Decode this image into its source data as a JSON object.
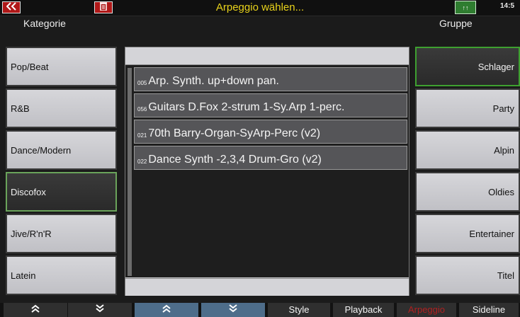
{
  "topbar": {
    "back_icon_label": "«",
    "title": "Arpeggio wählen...",
    "status_icon_label": "↑↑",
    "clock": "14:5"
  },
  "headers": {
    "left": "Kategorie",
    "right": "Gruppe"
  },
  "categories": [
    {
      "label": "Pop/Beat"
    },
    {
      "label": "R&B"
    },
    {
      "label": "Dance/Modern"
    },
    {
      "label": "Discofox"
    },
    {
      "label": "Jive/R'n'R"
    },
    {
      "label": "Latein"
    }
  ],
  "groups": [
    {
      "label": "Schlager"
    },
    {
      "label": "Party"
    },
    {
      "label": "Alpin"
    },
    {
      "label": "Oldies"
    },
    {
      "label": "Entertainer"
    },
    {
      "label": "Titel"
    }
  ],
  "arpeggios": [
    {
      "num": "005",
      "name": "Arp. Synth. up+down pan."
    },
    {
      "num": "056",
      "name": "Guitars D.Fox 2-strum 1-Sy.Arp 1-perc."
    },
    {
      "num": "021",
      "name": "70th Barry-Organ-SyArp-Perc (v2)"
    },
    {
      "num": "022",
      "name": "Dance Synth -2,3,4 Drum-Gro (v2)"
    }
  ],
  "bottombar": {
    "up_label": "≈",
    "down_label": "≈",
    "style_label": "Style",
    "playback_label": "Playback",
    "arpeggio_label": "Arpeggio",
    "sideline_label": "Sideline"
  },
  "colors": {
    "title": "#e8d21a",
    "active_border_left": "#6aa35a",
    "active_border_right": "#3ea030",
    "arpeggio_tab": "#b02020"
  }
}
